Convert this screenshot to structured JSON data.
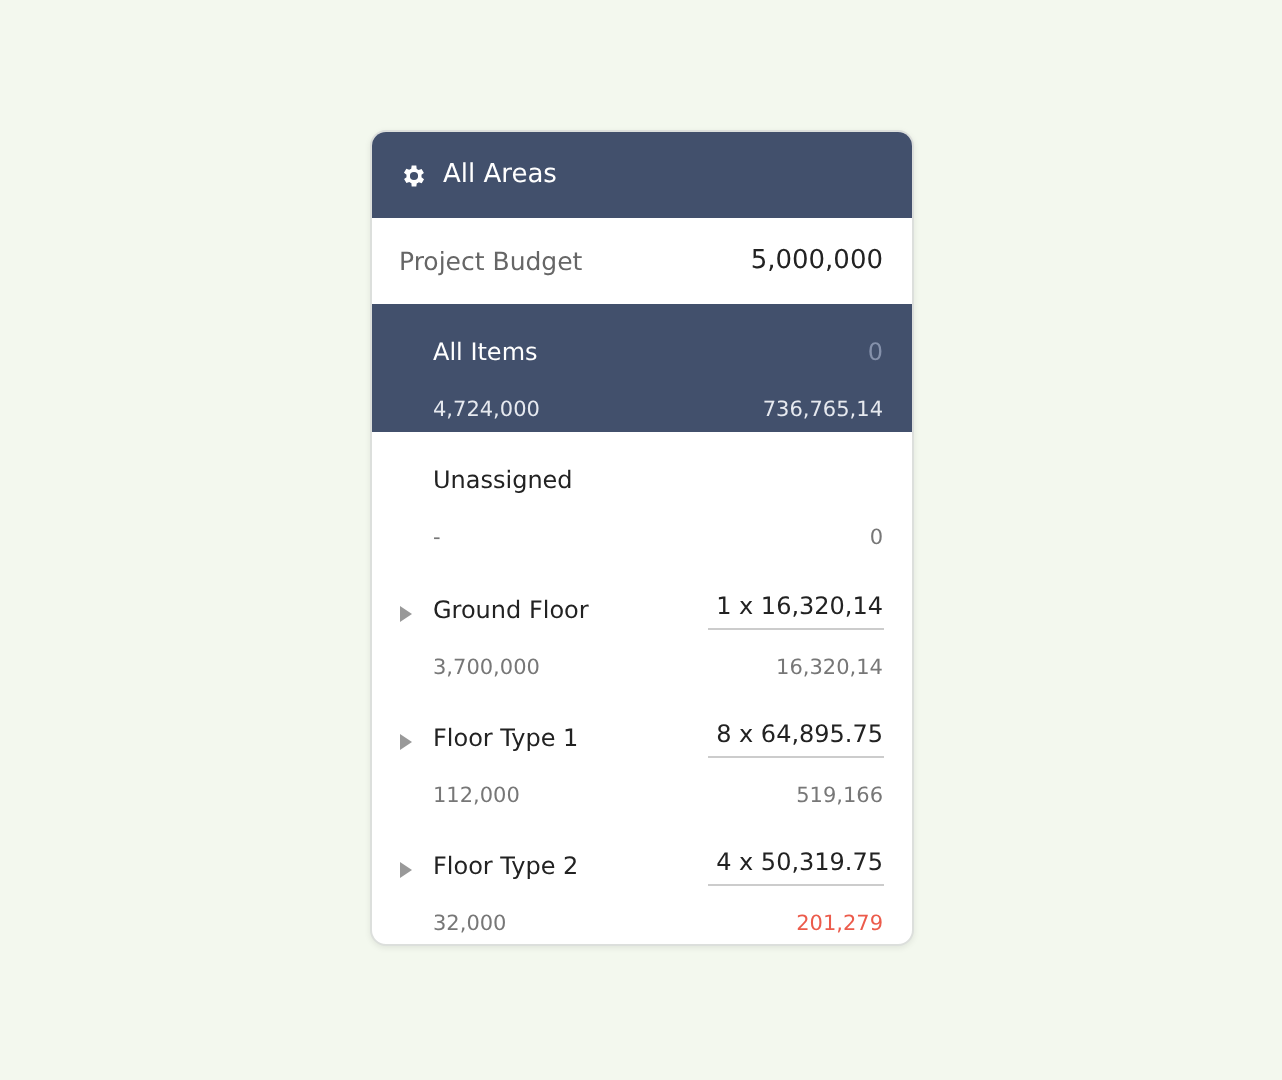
{
  "header": {
    "title": "All Areas"
  },
  "project_budget": {
    "label": "Project Budget",
    "value": "5,000,000"
  },
  "items": [
    {
      "kind": "summary",
      "name": "All Items",
      "quantity": "0",
      "budget": "4,724,000",
      "total": "736,765,14",
      "selected": true,
      "expandable": false,
      "over_budget": false
    },
    {
      "kind": "summary",
      "name": "Unassigned",
      "budget": "-",
      "total": "0",
      "selected": false,
      "expandable": false,
      "over_budget": false
    },
    {
      "kind": "area",
      "name": "Ground Floor",
      "quantity": "1 x 16,320,14",
      "budget": "3,700,000",
      "total": "16,320,14",
      "selected": false,
      "expandable": true,
      "over_budget": false
    },
    {
      "kind": "area",
      "name": "Floor Type 1",
      "quantity": "8 x 64,895.75",
      "budget": "112,000",
      "total": "519,166",
      "selected": false,
      "expandable": true,
      "over_budget": false
    },
    {
      "kind": "area",
      "name": "Floor Type 2",
      "quantity": "4 x 50,319.75",
      "budget": "32,000",
      "total": "201,279",
      "selected": false,
      "expandable": true,
      "over_budget": true
    }
  ]
}
